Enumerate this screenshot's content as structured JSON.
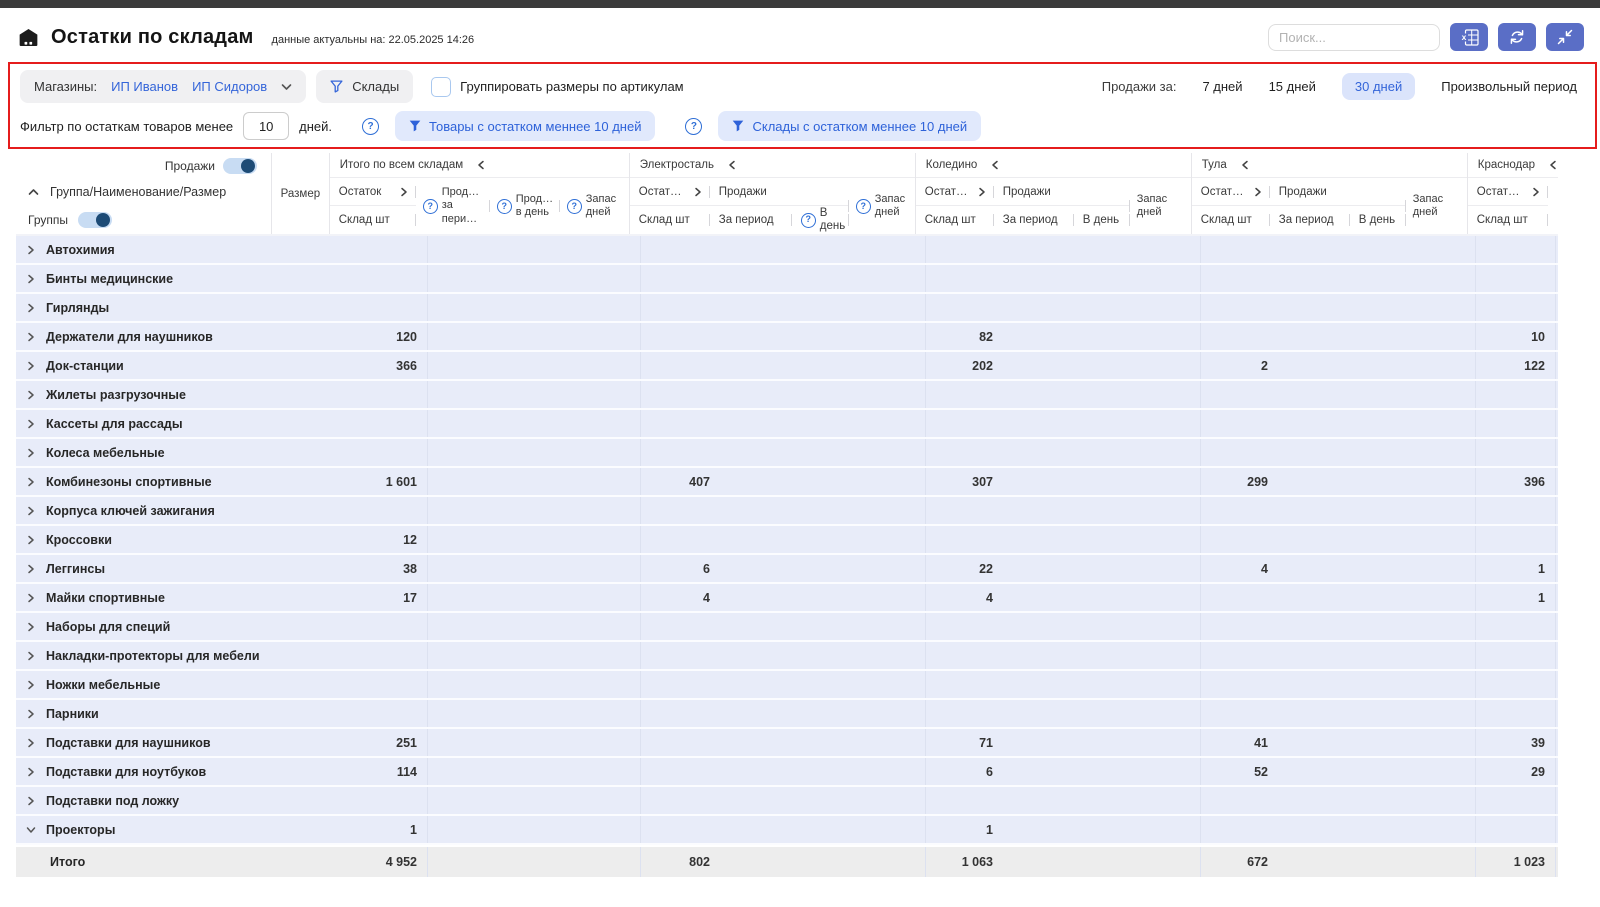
{
  "header": {
    "title": "Остатки по складам",
    "subtitle": "данные актуальны на: 22.05.2025 14:26",
    "search_placeholder": "Поиск...",
    "toolbar_icons": [
      "excel-export",
      "refresh",
      "collapse"
    ]
  },
  "filters": {
    "shops_label": "Магазины:",
    "shop1": "ИП Иванов",
    "shop2": "ИП Сидоров",
    "warehouses_button": "Склады",
    "group_checkbox_label": "Группировать размеры по артикулам",
    "sales_label": "Продажи за:",
    "period_7": "7 дней",
    "period_15": "15 дней",
    "period_30": "30 дней",
    "period_custom": "Произвольный период",
    "selected_period": "30 дней",
    "stock_label": "Фильтр по остаткам товаров менее",
    "stock_value": "10",
    "stock_suffix": "дней.",
    "btn_products": "Товары с остатком меннее 10 дней",
    "btn_warehouses": "Склады с остатком меннее 10 дней"
  },
  "table": {
    "sales_toggle_label": "Продажи",
    "groups_toggle_label": "Группы",
    "name_header": "Группа/Наименование/Размер",
    "size_header": "Размер",
    "sections": [
      {
        "layout": "totals",
        "title": "Итого по всем складам",
        "stock": "Остаток",
        "stock_sub": "Склад шт",
        "cols": [
          {
            "label": "Прод… за пери…",
            "help": true
          },
          {
            "label": "Прод… в день",
            "help": true
          },
          {
            "label": "Запас дней",
            "help": true
          }
        ]
      },
      {
        "layout": "warehouse",
        "title": "Электросталь",
        "stock": "Остат…",
        "stock_sub": "Склад шт",
        "sales": "Продажи",
        "period": {
          "label": "За период",
          "help": false
        },
        "day": {
          "label": "В день",
          "help": true
        },
        "zapas": {
          "label": "Запас дней",
          "help": true
        }
      },
      {
        "layout": "warehouse",
        "title": "Коледино",
        "stock": "Остат…",
        "stock_sub": "Склад шт",
        "sales": "Продажи",
        "period": {
          "label": "За период",
          "help": false
        },
        "day": {
          "label": "В день",
          "help": false
        },
        "zapas": {
          "label": "Запас дней",
          "help": false
        }
      },
      {
        "layout": "warehouse",
        "title": "Тула",
        "stock": "Остат…",
        "stock_sub": "Склад шт",
        "sales": "Продажи",
        "period": {
          "label": "За период",
          "help": false
        },
        "day": {
          "label": "В день",
          "help": false
        },
        "zapas": {
          "label": "Запас дней",
          "help": false
        }
      },
      {
        "layout": "stock_only",
        "title": "Краснодар",
        "stock": "Остат…",
        "stock_sub": "Склад шт"
      }
    ],
    "rows": [
      {
        "name": "Автохимия",
        "values": [
          "",
          "",
          "",
          "",
          ""
        ]
      },
      {
        "name": "Бинты медицинские",
        "values": [
          "",
          "",
          "",
          "",
          ""
        ]
      },
      {
        "name": "Гирлянды",
        "values": [
          "",
          "",
          "",
          "",
          ""
        ]
      },
      {
        "name": "Держатели для наушников",
        "values": [
          "120",
          "",
          "82",
          "",
          "10"
        ]
      },
      {
        "name": "Док-станции",
        "values": [
          "366",
          "",
          "202",
          "2",
          "122"
        ]
      },
      {
        "name": "Жилеты разгрузочные",
        "values": [
          "",
          "",
          "",
          "",
          ""
        ]
      },
      {
        "name": "Кассеты для рассады",
        "values": [
          "",
          "",
          "",
          "",
          ""
        ]
      },
      {
        "name": "Колеса мебельные",
        "values": [
          "",
          "",
          "",
          "",
          ""
        ]
      },
      {
        "name": "Комбинезоны спортивные",
        "values": [
          "1 601",
          "407",
          "307",
          "299",
          "396"
        ]
      },
      {
        "name": "Корпуса ключей зажигания",
        "values": [
          "",
          "",
          "",
          "",
          ""
        ]
      },
      {
        "name": "Кроссовки",
        "values": [
          "12",
          "",
          "",
          "",
          ""
        ]
      },
      {
        "name": "Леггинсы",
        "values": [
          "38",
          "6",
          "22",
          "4",
          "1"
        ]
      },
      {
        "name": "Майки спортивные",
        "values": [
          "17",
          "4",
          "4",
          "",
          "1"
        ]
      },
      {
        "name": "Наборы для специй",
        "values": [
          "",
          "",
          "",
          "",
          ""
        ]
      },
      {
        "name": "Накладки-протекторы для мебели",
        "values": [
          "",
          "",
          "",
          "",
          ""
        ]
      },
      {
        "name": "Ножки мебельные",
        "values": [
          "",
          "",
          "",
          "",
          ""
        ]
      },
      {
        "name": "Парники",
        "values": [
          "",
          "",
          "",
          "",
          ""
        ]
      },
      {
        "name": "Подставки для наушников",
        "values": [
          "251",
          "",
          "71",
          "41",
          "39"
        ]
      },
      {
        "name": "Подставки для ноутбуков",
        "values": [
          "114",
          "",
          "6",
          "52",
          "29"
        ]
      },
      {
        "name": "Подставки под ложку",
        "values": [
          "",
          "",
          "",
          "",
          ""
        ]
      },
      {
        "name": "Проекторы",
        "expanded": true,
        "values": [
          "1",
          "",
          "1",
          "",
          ""
        ]
      }
    ],
    "footer": {
      "label": "Итого",
      "values": [
        "4 952",
        "802",
        "1 063",
        "672",
        "1 023"
      ]
    }
  },
  "colors": {
    "accent_button": "#5a6ec6",
    "link_blue": "#3465d9",
    "row_background": "#e8ecf9",
    "footer_background": "#ededed",
    "selected_pill": "#dbe4fb",
    "annotation_red": "#e51c1c",
    "toggle_knob": "#1d4b76"
  }
}
